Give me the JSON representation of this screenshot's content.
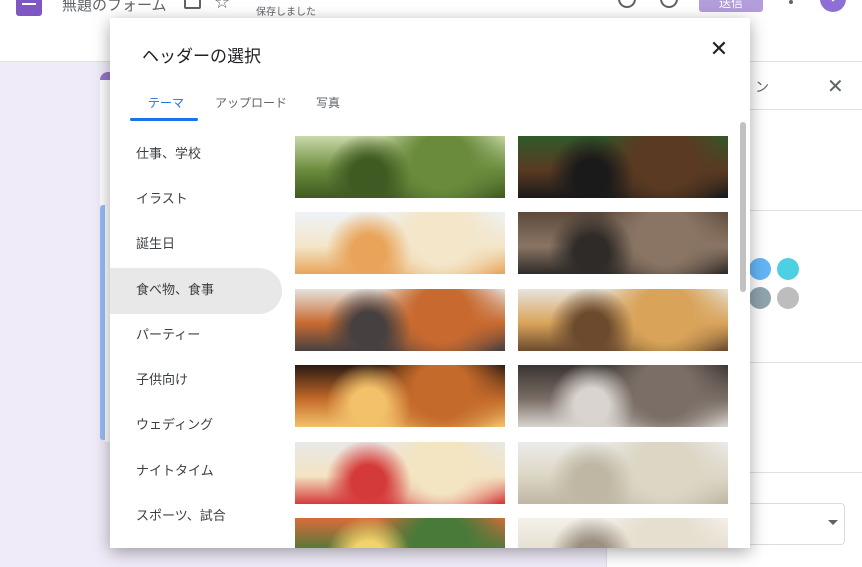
{
  "topbar": {
    "title": "無題のフォーム",
    "saved_status": "保存しました",
    "send_label": "送信"
  },
  "side_panel": {
    "title": "ン",
    "color_dots": [
      "#64b5f6",
      "#4dd0e1",
      "#90a4ae",
      "#bdbdbd"
    ]
  },
  "dialog": {
    "title": "ヘッダーの選択",
    "tabs": [
      {
        "label": "テーマ",
        "active": true
      },
      {
        "label": "アップロード",
        "active": false
      },
      {
        "label": "写真",
        "active": false
      }
    ],
    "categories": [
      {
        "label": "仕事、学校",
        "selected": false
      },
      {
        "label": "イラスト",
        "selected": false
      },
      {
        "label": "誕生日",
        "selected": false
      },
      {
        "label": "食べ物、食事",
        "selected": true
      },
      {
        "label": "パーティー",
        "selected": false
      },
      {
        "label": "子供向け",
        "selected": false
      },
      {
        "label": "ウェディング",
        "selected": false
      },
      {
        "label": "ナイトタイム",
        "selected": false
      },
      {
        "label": "スポーツ、試合",
        "selected": false
      }
    ],
    "thumbnails": [
      {
        "name": "picnic-photo",
        "colors": [
          "#c9d9a8",
          "#6a8b3c",
          "#3f5a22"
        ]
      },
      {
        "name": "grilled-steak-photo",
        "colors": [
          "#2f5a2a",
          "#5a3a22",
          "#1a1a1a"
        ]
      },
      {
        "name": "birthday-cake-photo",
        "colors": [
          "#eef3f8",
          "#f3e6c9",
          "#e9a45a"
        ]
      },
      {
        "name": "dinner-table-photo",
        "colors": [
          "#5d4a3b",
          "#8a7564",
          "#2f2b28"
        ]
      },
      {
        "name": "cocktails-photo",
        "colors": [
          "#e6e2dd",
          "#c86a30",
          "#474040"
        ]
      },
      {
        "name": "pancakes-photo",
        "colors": [
          "#e7e3dc",
          "#d9a45a",
          "#6b4a2e"
        ]
      },
      {
        "name": "candlelight-dinner-photo",
        "colors": [
          "#2a1a12",
          "#c46a2a",
          "#f2c26a"
        ]
      },
      {
        "name": "party-crowd-photo",
        "colors": [
          "#3a3432",
          "#7a6e66",
          "#d9d4cf"
        ]
      },
      {
        "name": "popcorn-photo",
        "colors": [
          "#e8e8e8",
          "#f3e4c2",
          "#d53a3a"
        ]
      },
      {
        "name": "champagne-photo",
        "colors": [
          "#ececeb",
          "#dcd6c4",
          "#bfb7a4"
        ]
      },
      {
        "name": "buffet-photo",
        "colors": [
          "#d96b3a",
          "#4a7a3a",
          "#f2d36a"
        ]
      },
      {
        "name": "kitchen-photo",
        "colors": [
          "#f4f1ea",
          "#e6dfd0",
          "#9a8f80"
        ]
      }
    ]
  }
}
